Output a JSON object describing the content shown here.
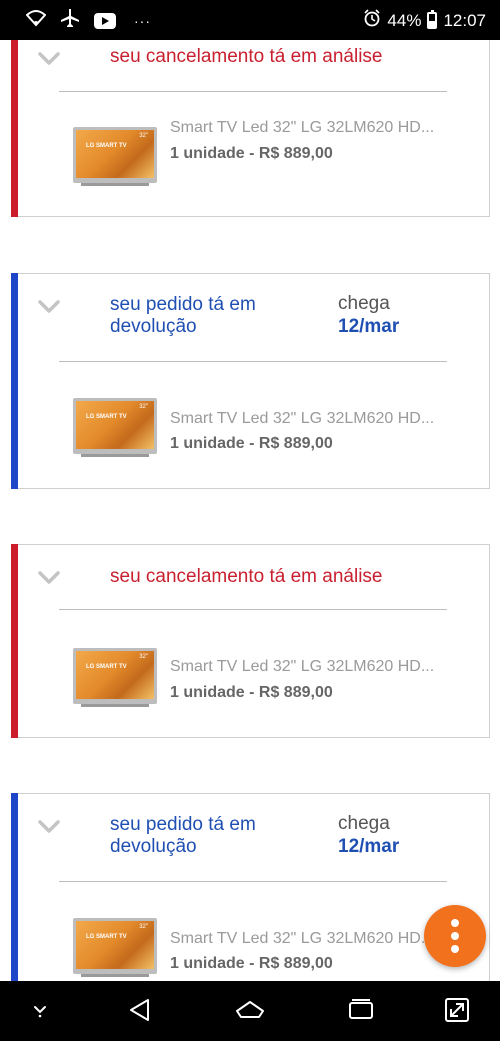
{
  "status_bar": {
    "battery": "44%",
    "time": "12:07",
    "overflow": "···",
    "icons": [
      "wifi-icon",
      "airplane-icon",
      "youtube-icon",
      "alarm-icon",
      "battery-icon"
    ]
  },
  "orders": [
    {
      "status": "seu cancelamento tá em análise",
      "product_name": "Smart TV Led 32\" LG 32LM620 HD...",
      "quantity_price": "1 unidade - R$ 889,00"
    },
    {
      "status_line1": "seu pedido tá em",
      "status_line2": "devolução",
      "arrival_label": "chega",
      "arrival_date": "12/mar",
      "product_name": "Smart TV Led 32\" LG 32LM620 HD...",
      "quantity_price": "1 unidade - R$ 889,00"
    },
    {
      "status": "seu cancelamento tá em análise",
      "product_name": "Smart TV Led 32\" LG 32LM620 HD...",
      "quantity_price": "1 unidade - R$ 889,00"
    },
    {
      "status_line1": "seu pedido tá em",
      "status_line2": "devolução",
      "arrival_label": "chega",
      "arrival_date": "12/mar",
      "product_name": "Smart TV Led 32\" LG 32LM620 HD...",
      "quantity_price": "1 unidade - R$ 889,00"
    }
  ],
  "colors": {
    "cancel_accent": "#cc1b2b",
    "return_accent": "#1e46c8",
    "fab": "#f2711c"
  },
  "nav_bar": {
    "icons": [
      "notification-drawer-icon",
      "back-icon",
      "home-icon",
      "recents-icon",
      "expand-icon"
    ]
  }
}
